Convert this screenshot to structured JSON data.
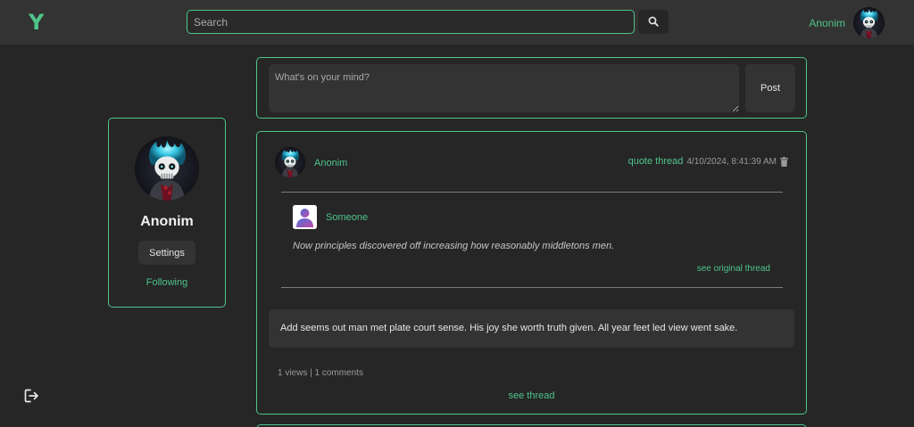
{
  "app": {
    "logo": "Y"
  },
  "search": {
    "placeholder": "Search",
    "value": "",
    "icon": "search-icon"
  },
  "user": {
    "name": "Anonim"
  },
  "profile": {
    "name": "Anonim",
    "settings_label": "Settings",
    "following_label": "Following"
  },
  "composer": {
    "placeholder": "What's on your mind?",
    "post_label": "Post"
  },
  "thread": {
    "author": "Anonim",
    "type_label": "quote thread",
    "timestamp": "4/10/2024, 8:41:39 AM",
    "quoted": {
      "author": "Someone",
      "text": "Now principles discovered off increasing how reasonably middletons men.",
      "link_label": "see original thread"
    },
    "body": "Add seems out man met plate court sense. His joy she worth truth given. All year feet led view went sake.",
    "stats": "1 views | 1 comments",
    "link_label": "see thread"
  },
  "colors": {
    "accent": "#4fc48b",
    "background": "#262626",
    "topbar": "#333333"
  },
  "icons": {
    "trash": "trash-icon",
    "logout": "logout-icon",
    "default_avatar": "user-placeholder-icon"
  }
}
